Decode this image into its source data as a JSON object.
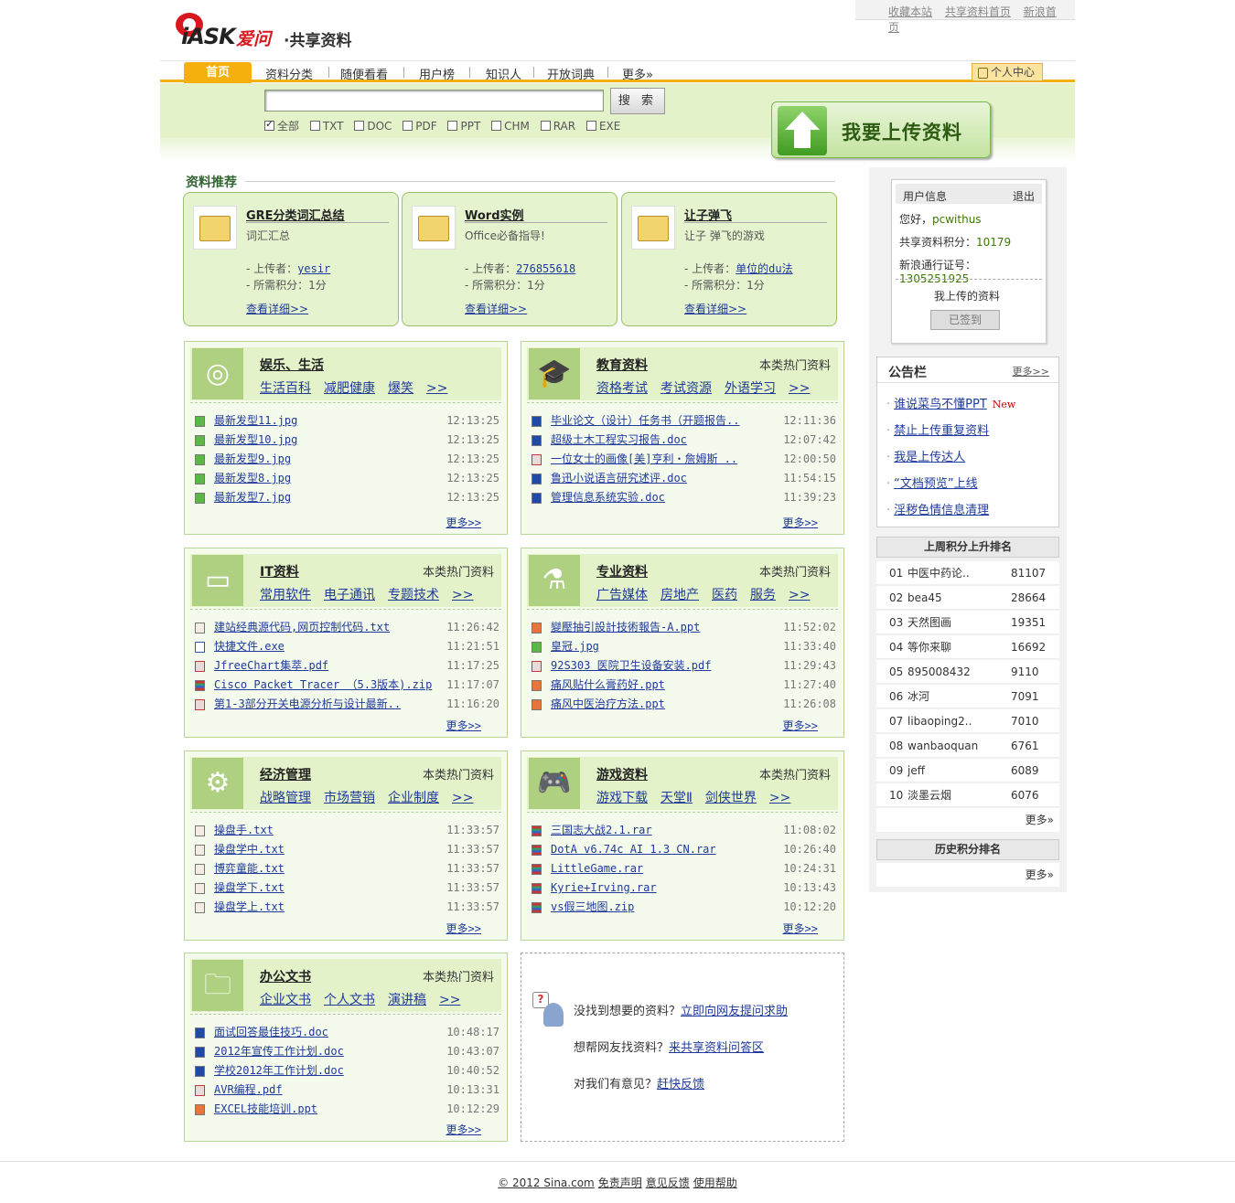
{
  "top_links": [
    "收藏本站",
    "共享资料首页",
    "新浪首页"
  ],
  "logo": {
    "ask": "iASK",
    "iwen": "爱问",
    "share": "·共享资料"
  },
  "nav": {
    "home": "首页",
    "items": [
      "资料分类",
      "随便看看",
      "用户榜",
      "知识人",
      "开放词典",
      "更多»"
    ],
    "personal": "个人中心"
  },
  "search": {
    "value": "",
    "button": "搜 索",
    "filters": [
      "全部",
      "TXT",
      "DOC",
      "PDF",
      "PPT",
      "CHM",
      "RAR",
      "EXE"
    ]
  },
  "upload_label": "我要上传资料",
  "recommend": {
    "title": "资料推荐",
    "uploader_label": "- 上传者：",
    "points_label": "- 所需积分：",
    "more": "查看详细>>",
    "items": [
      {
        "title": "GRE分类词汇总结",
        "desc": "词汇汇总",
        "uploader": "yesir",
        "points": "1分"
      },
      {
        "title": "Word实例",
        "desc": "Office必备指导!",
        "uploader": "276855618",
        "points": "1分"
      },
      {
        "title": "让子弹飞",
        "desc": "让子 弹飞的游戏",
        "uploader": "单位的du法",
        "points": "1分"
      }
    ]
  },
  "categories": [
    {
      "name": "娱乐、生活",
      "hot": "",
      "icon": "target-icon",
      "glyph": "◎",
      "subs": [
        "生活百科",
        "减肥健康",
        "爆笑",
        ">>"
      ],
      "files": [
        {
          "type": "img",
          "name": "最新发型11.jpg",
          "time": "12:13:25"
        },
        {
          "type": "img",
          "name": "最新发型10.jpg",
          "time": "12:13:25"
        },
        {
          "type": "img",
          "name": "最新发型9.jpg",
          "time": "12:13:25"
        },
        {
          "type": "img",
          "name": "最新发型8.jpg",
          "time": "12:13:25"
        },
        {
          "type": "img",
          "name": "最新发型7.jpg",
          "time": "12:13:25"
        }
      ]
    },
    {
      "name": "教育资料",
      "hot": "本类热门资料",
      "icon": "graduation-cap-icon",
      "glyph": "🎓",
      "subs": [
        "资格考试",
        "考试资源",
        "外语学习",
        ">>"
      ],
      "files": [
        {
          "type": "doc",
          "name": "毕业论文（设计）任务书（开题报告..",
          "time": "12:11:36"
        },
        {
          "type": "doc",
          "name": "超级土木工程实习报告.doc",
          "time": "12:07:42"
        },
        {
          "type": "pdf",
          "name": "一位女士的画像[美]亨利・詹姆斯 ..",
          "time": "12:00:50"
        },
        {
          "type": "doc",
          "name": "鲁迅小说语言研究述评.doc",
          "time": "11:54:15"
        },
        {
          "type": "doc",
          "name": "管理信息系统实验.doc",
          "time": "11:39:23"
        }
      ]
    },
    {
      "name": "IT资料",
      "hot": "本类热门资料",
      "icon": "monitor-icon",
      "glyph": "▭",
      "subs": [
        "常用软件",
        "电子通讯",
        "专题技术",
        ">>"
      ],
      "files": [
        {
          "type": "txt",
          "name": "建站经典源代码,网页控制代码.txt",
          "time": "11:26:42"
        },
        {
          "type": "exe",
          "name": "快捷文件.exe",
          "time": "11:21:51"
        },
        {
          "type": "pdf",
          "name": "JfreeChart集萃.pdf",
          "time": "11:17:25"
        },
        {
          "type": "zip",
          "name": "Cisco Packet Tracer （5.3版本).zip",
          "time": "11:17:07"
        },
        {
          "type": "pdf",
          "name": "第1-3部分开关电源分析与设计最新..",
          "time": "11:16:20"
        }
      ]
    },
    {
      "name": "专业资料",
      "hot": "本类热门资料",
      "icon": "flask-icon",
      "glyph": "⚗",
      "subs": [
        "广告媒体",
        "房地产",
        "医药",
        "服务",
        ">>"
      ],
      "files": [
        {
          "type": "ppt",
          "name": "變壓抽引設計技術報告-A.ppt",
          "time": "11:52:02"
        },
        {
          "type": "img",
          "name": "皇冠.jpg",
          "time": "11:33:40"
        },
        {
          "type": "pdf",
          "name": "92S303 医院卫生设备安装.pdf",
          "time": "11:29:43"
        },
        {
          "type": "ppt",
          "name": "痛风贴什么膏药好.ppt",
          "time": "11:27:40"
        },
        {
          "type": "ppt",
          "name": "痛风中医治疗方法.ppt",
          "time": "11:26:08"
        }
      ]
    },
    {
      "name": "经济管理",
      "hot": "本类热门资料",
      "icon": "gear-icon",
      "glyph": "⚙",
      "subs": [
        "战略管理",
        "市场营销",
        "企业制度",
        ">>"
      ],
      "files": [
        {
          "type": "txt",
          "name": "操盘手.txt",
          "time": "11:33:57"
        },
        {
          "type": "txt",
          "name": "操盘学中.txt",
          "time": "11:33:57"
        },
        {
          "type": "txt",
          "name": "博弈童能.txt",
          "time": "11:33:57"
        },
        {
          "type": "txt",
          "name": "操盘学下.txt",
          "time": "11:33:57"
        },
        {
          "type": "txt",
          "name": "操盘学上.txt",
          "time": "11:33:57"
        }
      ]
    },
    {
      "name": "游戏资料",
      "hot": "本类热门资料",
      "icon": "gamepad-icon",
      "glyph": "🎮",
      "subs": [
        "游戏下载",
        "天堂Ⅱ",
        "剑侠世界",
        ">>"
      ],
      "files": [
        {
          "type": "zip",
          "name": "三国志大战2.1.rar",
          "time": "11:08:02"
        },
        {
          "type": "zip",
          "name": "DotA v6.74c AI 1.3 CN.rar",
          "time": "10:26:40"
        },
        {
          "type": "zip",
          "name": "LittleGame.rar",
          "time": "10:24:31"
        },
        {
          "type": "zip",
          "name": "Kyrie+Irving.rar",
          "time": "10:13:43"
        },
        {
          "type": "zip",
          "name": "vs假三地图.zip",
          "time": "10:12:20"
        }
      ]
    },
    {
      "name": "办公文书",
      "hot": "本类热门资料",
      "icon": "folder-icon",
      "glyph": "🗀",
      "subs": [
        "企业文书",
        "个人文书",
        "演讲稿",
        ">>"
      ],
      "files": [
        {
          "type": "doc",
          "name": "面试回答最佳技巧.doc",
          "time": "10:48:17"
        },
        {
          "type": "doc",
          "name": "2012年宣传工作计划.doc",
          "time": "10:43:07"
        },
        {
          "type": "doc",
          "name": "学校2012年工作计划.doc",
          "time": "10:40:52"
        },
        {
          "type": "pdf",
          "name": "AVR编程.pdf",
          "time": "10:13:31"
        },
        {
          "type": "ppt",
          "name": "EXCEL技能培训.ppt",
          "time": "10:12:29"
        }
      ]
    }
  ],
  "more_label": "更多>>",
  "help": [
    {
      "text": "没找到想要的资料？",
      "link": "立即向网友提问求助"
    },
    {
      "text": "想帮网友找资料？",
      "link": "来共享资料问答区"
    },
    {
      "text": "对我们有意见？",
      "link": "赶快反馈"
    }
  ],
  "user": {
    "header": "用户信息",
    "logout": "退出",
    "greeting": "您好，",
    "name": "pcwithus",
    "points_label": "共享资料积分：",
    "points": "10179",
    "pass_label": "新浪通行证号：",
    "pass": "1305251925",
    "my_uploads": "我上传的资料",
    "signed": "已签到"
  },
  "notice": {
    "title": "公告栏",
    "more": "更多>>",
    "items": [
      "谁说菜鸟不懂PPT",
      "禁止上传重复资料",
      "我是上传达人",
      "“文档预览”上线",
      "淫秽色情信息清理"
    ],
    "new_label": "New"
  },
  "weekly_rank": {
    "title": "上周积分上升排名",
    "rows": [
      {
        "n": "01",
        "name": "中医中药论..",
        "score": "81107"
      },
      {
        "n": "02",
        "name": "bea45",
        "score": "28664"
      },
      {
        "n": "03",
        "name": "天然图画",
        "score": "19351"
      },
      {
        "n": "04",
        "name": "等你来聊",
        "score": "16692"
      },
      {
        "n": "05",
        "name": "895008432",
        "score": "9110"
      },
      {
        "n": "06",
        "name": "冰河",
        "score": "7091"
      },
      {
        "n": "07",
        "name": "libaoping2..",
        "score": "7010"
      },
      {
        "n": "08",
        "name": "wanbaoquan",
        "score": "6761"
      },
      {
        "n": "09",
        "name": "jeff",
        "score": "6089"
      },
      {
        "n": "10",
        "name": "淡墨云烟",
        "score": "6076"
      }
    ],
    "more": "更多»"
  },
  "history_rank": {
    "title": "历史积分排名",
    "more": "更多»"
  },
  "footer": [
    "© 2012 Sina.com",
    "免责声明",
    "意见反馈",
    "使用帮助"
  ]
}
